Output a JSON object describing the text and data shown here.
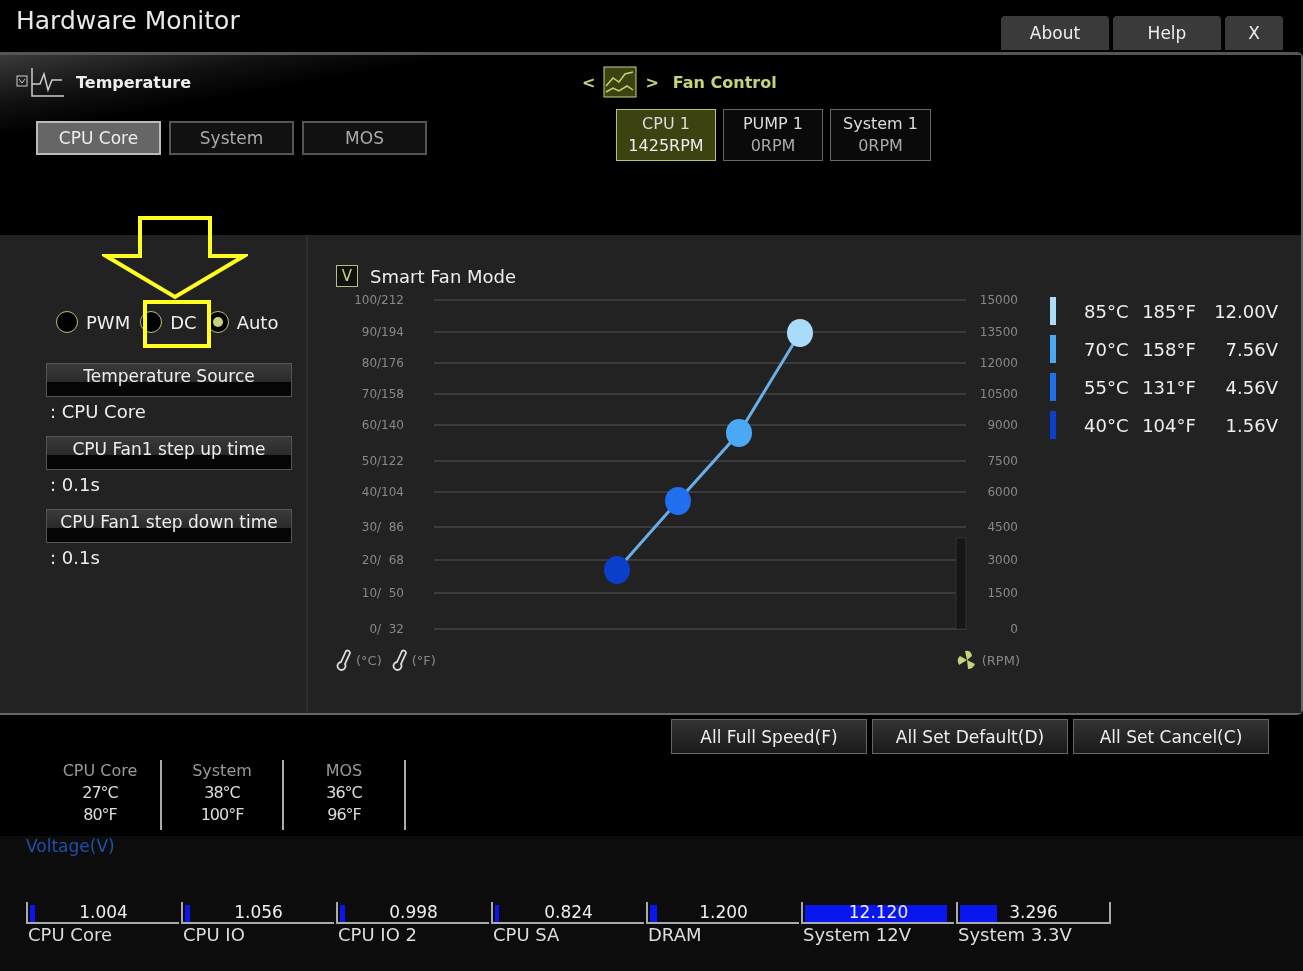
{
  "window": {
    "title": "Hardware Monitor"
  },
  "header_buttons": [
    {
      "label": "About"
    },
    {
      "label": "Help"
    },
    {
      "label": "X"
    }
  ],
  "temperature": {
    "title": "Temperature",
    "tabs": [
      {
        "label": "CPU Core",
        "selected": true
      },
      {
        "label": "System",
        "selected": false
      },
      {
        "label": "MOS",
        "selected": false
      }
    ]
  },
  "fan_control": {
    "prev": "<",
    "next": ">",
    "title": "Fan Control",
    "fans": [
      {
        "name": "CPU 1",
        "rpm": "1425RPM",
        "selected": true
      },
      {
        "name": "PUMP 1",
        "rpm": "0RPM",
        "selected": false
      },
      {
        "name": "System 1",
        "rpm": "0RPM",
        "selected": false
      }
    ]
  },
  "mode_options": [
    {
      "label": "PWM",
      "selected": false
    },
    {
      "label": "DC",
      "selected": false
    },
    {
      "label": "Auto",
      "selected": true
    }
  ],
  "settings": [
    {
      "label": "Temperature Source",
      "value": ": CPU Core"
    },
    {
      "label": "CPU Fan1 step up time",
      "value": ": 0.1s"
    },
    {
      "label": "CPU Fan1 step down time",
      "value": ": 0.1s"
    }
  ],
  "smart_fan": {
    "checkbox_mark": "V",
    "label": "Smart Fan Mode",
    "checked": true,
    "left_axis_labels": [
      "100/212",
      "90/194",
      "80/176",
      "70/158",
      "60/140",
      "50/122",
      "40/104",
      "30/  86",
      "20/  68",
      "10/  50",
      "0/  32"
    ],
    "right_axis_labels": [
      "15000",
      "13500",
      "12000",
      "10500",
      "9000",
      "7500",
      "6000",
      "4500",
      "3000",
      "1500",
      "0"
    ],
    "unit_celsius": "(°C)",
    "unit_fahrenheit": "(°F)",
    "unit_rpm": "(RPM)",
    "legend": [
      {
        "celsius": "85°C",
        "fahrenheit": "185°F",
        "voltage": "12.00V",
        "color": "#a8dcf8"
      },
      {
        "celsius": "70°C",
        "fahrenheit": "158°F",
        "voltage": "7.56V",
        "color": "#4aa8f5"
      },
      {
        "celsius": "55°C",
        "fahrenheit": "131°F",
        "voltage": "4.56V",
        "color": "#1f6fee"
      },
      {
        "celsius": "40°C",
        "fahrenheit": "104°F",
        "voltage": "1.56V",
        "color": "#0a3fcc"
      }
    ]
  },
  "action_buttons": [
    {
      "label": "All Full Speed(F)"
    },
    {
      "label": "All Set Default(D)"
    },
    {
      "label": "All Set Cancel(C)"
    }
  ],
  "readings": [
    {
      "name": "CPU Core",
      "celsius": "27°C",
      "fahrenheit": "80°F"
    },
    {
      "name": "System",
      "celsius": "38°C",
      "fahrenheit": "100°F"
    },
    {
      "name": "MOS",
      "celsius": "36°C",
      "fahrenheit": "96°F"
    }
  ],
  "voltage": {
    "title": "Voltage(V)",
    "items": [
      {
        "name": "CPU Core",
        "value": "1.004",
        "level": 0.06
      },
      {
        "name": "CPU IO",
        "value": "1.056",
        "level": 0.06
      },
      {
        "name": "CPU IO 2",
        "value": "0.998",
        "level": 0.06
      },
      {
        "name": "CPU SA",
        "value": "0.824",
        "level": 0.05
      },
      {
        "name": "DRAM",
        "value": "1.200",
        "level": 0.07
      },
      {
        "name": "System 12V",
        "value": "12.120",
        "level": 0.97
      },
      {
        "name": "System 3.3V",
        "value": "3.296",
        "level": 0.27
      }
    ]
  }
}
